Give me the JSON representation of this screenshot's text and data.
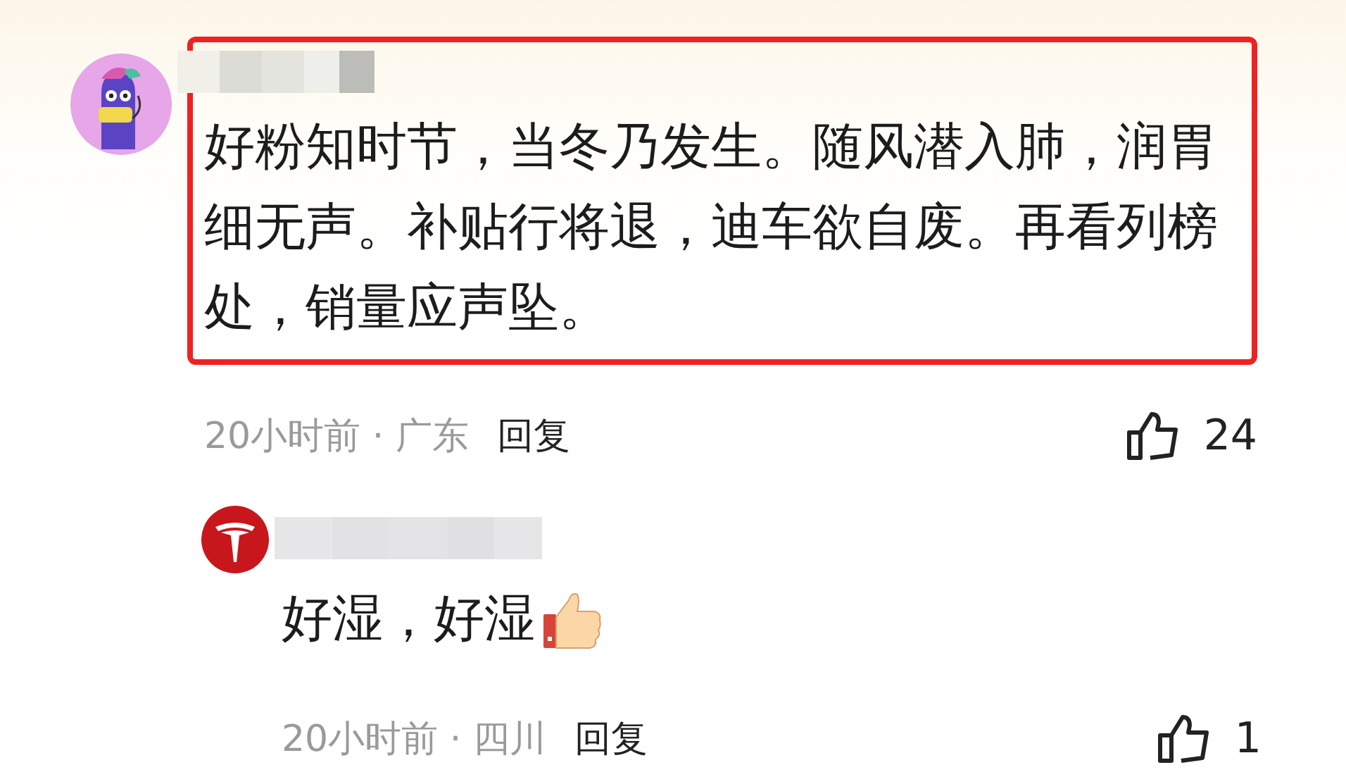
{
  "comments": [
    {
      "kind": "mascot",
      "text": "好粉知时节，当冬乃发生。随风潜入肺，润胃细无声。补贴行将退，迪车欲自废。再看列榜处，销量应声坠。",
      "highlighted": true,
      "meta": "20小时前 · 广东",
      "reply": "回复",
      "likes": "24",
      "emoji": false
    },
    {
      "kind": "logo",
      "text": "好湿，好湿",
      "highlighted": false,
      "meta": "20小时前 · 四川",
      "reply": "回复",
      "likes": "1",
      "emoji": true
    }
  ]
}
